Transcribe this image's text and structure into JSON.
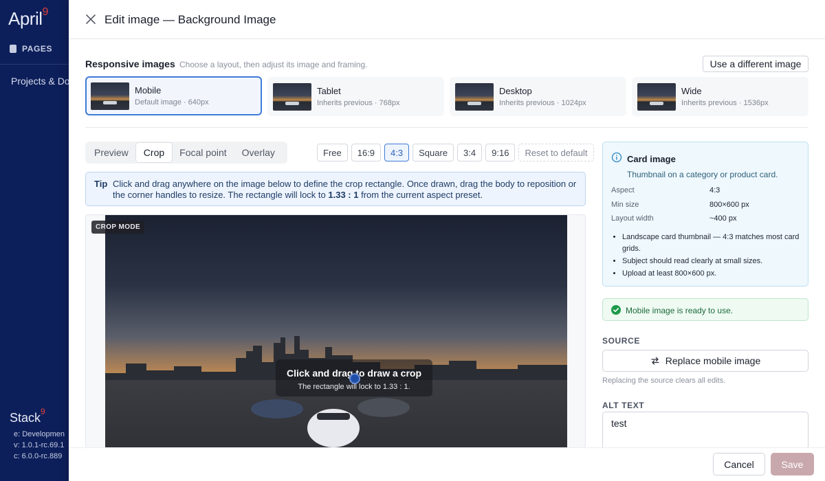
{
  "sidebar": {
    "brand": "April",
    "brand_badge": "9",
    "pages_label": "PAGES",
    "projects_label": "Projects & Do",
    "stack_label": "Stack",
    "stack_badge": "9",
    "env": "e: Developmen",
    "version_v": "v: 1.0.1-rc.69.1",
    "version_c": "c: 6.0.0-rc.889"
  },
  "modal": {
    "title": "Edit image — Background Image",
    "responsive_title": "Responsive images",
    "responsive_subtitle": "Choose a layout, then adjust its image and framing.",
    "different_image_label": "Use a different image",
    "layouts": [
      {
        "name": "Mobile",
        "desc": "Default image · 640px",
        "selected": true
      },
      {
        "name": "Tablet",
        "desc": "Inherits previous · 768px",
        "selected": false
      },
      {
        "name": "Desktop",
        "desc": "Inherits previous · 1024px",
        "selected": false
      },
      {
        "name": "Wide",
        "desc": "Inherits previous · 1536px",
        "selected": false
      }
    ],
    "tabs": [
      "Preview",
      "Crop",
      "Focal point",
      "Overlay"
    ],
    "active_tab": "Crop",
    "aspects": [
      "Free",
      "16:9",
      "4:3",
      "Square",
      "3:4",
      "9:16"
    ],
    "active_aspect": "4:3",
    "reset_label": "Reset to default",
    "tip": {
      "label": "Tip",
      "text_before": "Click and drag anywhere on the image below to define the crop rectangle. Once drawn, drag the body to reposition or the corner handles to resize. The rectangle will lock to ",
      "ratio": "1.33 : 1",
      "text_after": " from the current aspect preset."
    },
    "canvas": {
      "badge": "CROP MODE",
      "overlay_title": "Click and drag to draw a crop",
      "overlay_sub": "The rectangle will lock to 1.33 : 1."
    },
    "card_info": {
      "title": "Card image",
      "subtitle": "Thumbnail on a category or product card.",
      "aspect_label": "Aspect",
      "aspect_value": "4:3",
      "min_size_label": "Min size",
      "min_size_value": "800×600 px",
      "layout_width_label": "Layout width",
      "layout_width_value": "~400 px",
      "bullets": [
        "Landscape card thumbnail — 4:3 matches most card grids.",
        "Subject should read clearly at small sizes.",
        "Upload at least 800×600 px."
      ]
    },
    "ready_text": "Mobile image is ready to use.",
    "source_label": "SOURCE",
    "replace_label": "Replace mobile image",
    "replace_hint": "Replacing the source clears all edits.",
    "alt_label": "ALT TEXT",
    "alt_value": "test",
    "cancel_label": "Cancel",
    "save_label": "Save"
  },
  "colors": {
    "sidebar_bg": "#0d1f5a",
    "accent": "#3f7ad8",
    "save_disabled": "#c9a8ad",
    "success": "#1e9a4b",
    "info": "#2a86c4"
  }
}
